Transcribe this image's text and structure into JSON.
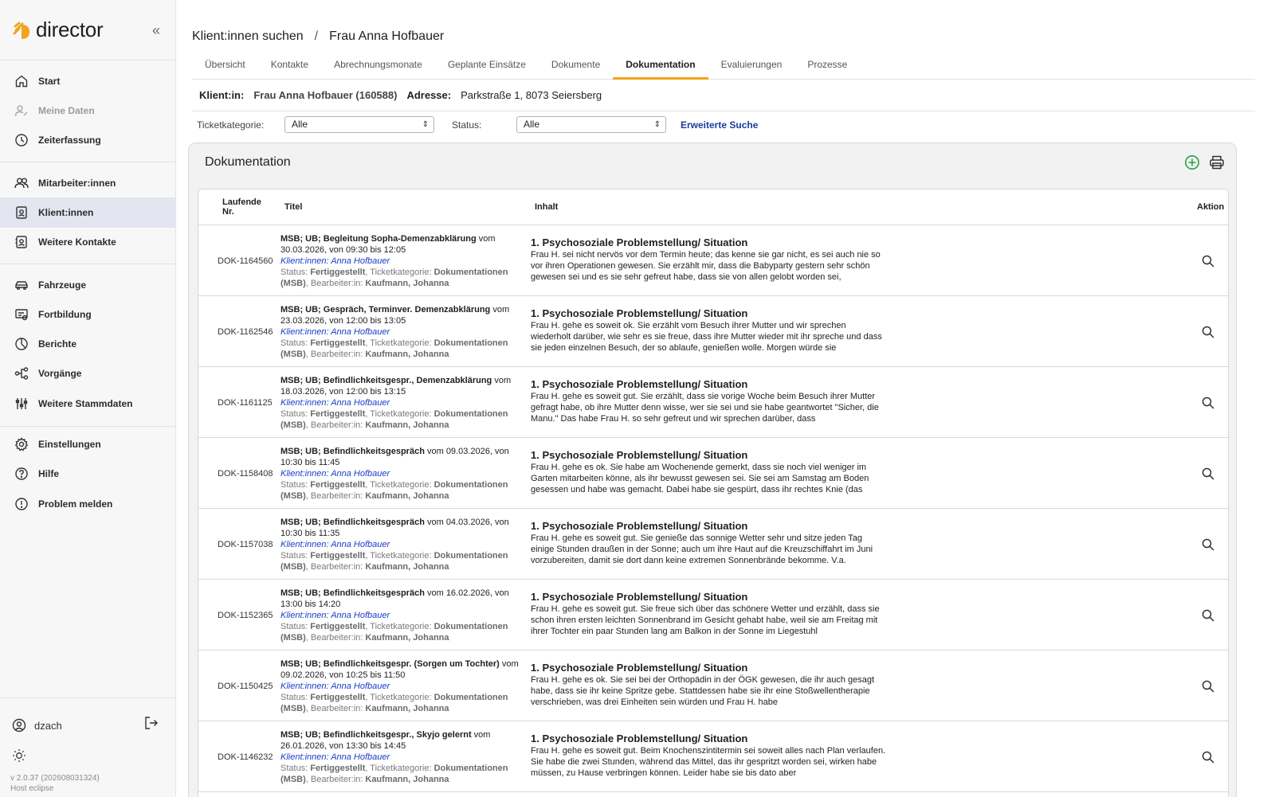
{
  "app": {
    "name": "director",
    "version": "v 2.0.37 (202608031324)",
    "host": "Host eclipse"
  },
  "sidebar": {
    "items": [
      {
        "label": "Start",
        "icon": "home-icon"
      },
      {
        "label": "Meine Daten",
        "icon": "user-edit-icon"
      },
      {
        "label": "Zeiterfassung",
        "icon": "clock-icon"
      },
      {
        "label": "Mitarbeiter:innen",
        "icon": "users-icon"
      },
      {
        "label": "Klient:innen",
        "icon": "badge-icon"
      },
      {
        "label": "Weitere Kontakte",
        "icon": "contact-icon"
      },
      {
        "label": "Fahrzeuge",
        "icon": "car-icon"
      },
      {
        "label": "Fortbildung",
        "icon": "training-icon"
      },
      {
        "label": "Berichte",
        "icon": "chart-pie-icon"
      },
      {
        "label": "Vorgänge",
        "icon": "workflow-icon"
      },
      {
        "label": "Weitere Stammdaten",
        "icon": "sliders-icon"
      },
      {
        "label": "Einstellungen",
        "icon": "gear-icon"
      },
      {
        "label": "Hilfe",
        "icon": "help-icon"
      },
      {
        "label": "Problem melden",
        "icon": "alert-icon"
      }
    ],
    "user": "dzach"
  },
  "breadcrumb": {
    "parent": "Klient:innen suchen",
    "sep": "/",
    "current": "Frau Anna Hofbauer"
  },
  "tabs": [
    "Übersicht",
    "Kontakte",
    "Abrechnungsmonate",
    "Geplante Einsätze",
    "Dokumente",
    "Dokumentation",
    "Evaluierungen",
    "Prozesse"
  ],
  "client": {
    "label": "Klient:in:",
    "name": "Frau Anna Hofbauer (160588)",
    "address_label": "Adresse:",
    "address": "Parkstraße 1, 8073 Seiersberg"
  },
  "filters": {
    "category_label": "Ticketkategorie:",
    "category_value": "Alle",
    "status_label": "Status:",
    "status_value": "Alle",
    "advanced": "Erweiterte Suche"
  },
  "panel": {
    "title": "Dokumentation"
  },
  "table": {
    "headers": {
      "nr": "Laufende",
      "nr2": "Nr.",
      "title": "Titel",
      "content": "Inhalt",
      "action": "Aktion"
    },
    "rows": [
      {
        "nr": "DOK-1164560",
        "title_bold": "MSB; UB; Begleitung Sopha-Demenzabklärung",
        "title_rest": " vom 30.03.2026, von 09:30 bis 12:05",
        "client": "Klient:innen: Anna Hofbauer",
        "status_pre": "Status: ",
        "status": "Fertiggestellt",
        "cat_pre": ", Ticketkategorie: ",
        "cat": "Dokumentationen (MSB)",
        "worker_pre": ", Bearbeiter:in: ",
        "worker": "Kaufmann, Johanna",
        "content_title": "1. Psychosoziale Problemstellung/ Situation",
        "content": "Frau H. sei nicht nervös vor dem Termin heute; das kenne sie gar nicht, es sei auch nie so vor ihren Operationen gewesen. Sie erzählt mir, dass die Babyparty gestern sehr schön gewesen sei und es sie sehr gefreut habe, dass sie von allen gelobt worden sei,"
      },
      {
        "nr": "DOK-1162546",
        "title_bold": "MSB; UB; Gespräch, Terminver. Demenzabklärung",
        "title_rest": " vom 23.03.2026, von 12:00 bis 13:05",
        "client": "Klient:innen: Anna Hofbauer",
        "status_pre": "Status: ",
        "status": "Fertiggestellt",
        "cat_pre": ", Ticketkategorie: ",
        "cat": "Dokumentationen (MSB)",
        "worker_pre": ", Bearbeiter:in: ",
        "worker": "Kaufmann, Johanna",
        "content_title": "1. Psychosoziale Problemstellung/ Situation",
        "content": "Frau H. gehe es soweit ok. Sie erzählt vom Besuch ihrer Mutter und wir sprechen wiederholt darüber, wie sehr es sie freue, dass ihre Mutter wieder mit ihr spreche und dass sie jeden einzelnen Besuch, der so ablaufe, genießen wolle. Morgen würde sie"
      },
      {
        "nr": "DOK-1161125",
        "title_bold": "MSB; UB; Befindlichkeitsgespr., Demenzabklärung",
        "title_rest": " vom 18.03.2026, von 12:00 bis 13:15",
        "client": "Klient:innen: Anna Hofbauer",
        "status_pre": "Status: ",
        "status": "Fertiggestellt",
        "cat_pre": ", Ticketkategorie: ",
        "cat": "Dokumentationen (MSB)",
        "worker_pre": ", Bearbeiter:in: ",
        "worker": "Kaufmann, Johanna",
        "content_title": "1. Psychosoziale Problemstellung/ Situation",
        "content": "Frau H. gehe es soweit gut. Sie erzählt, dass sie vorige Woche beim Besuch ihrer Mutter gefragt habe, ob ihre Mutter denn wisse, wer sie sei und sie habe geantwortet \"Sicher, die Manu.\" Das habe Frau H. so sehr gefreut und wir sprechen darüber, dass"
      },
      {
        "nr": "DOK-1158408",
        "title_bold": "MSB; UB; Befindlichkeitsgespräch",
        "title_rest": " vom 09.03.2026, von 10:30 bis 11:45",
        "client": "Klient:innen: Anna Hofbauer",
        "status_pre": "Status: ",
        "status": "Fertiggestellt",
        "cat_pre": ", Ticketkategorie: ",
        "cat": "Dokumentationen (MSB)",
        "worker_pre": ", Bearbeiter:in: ",
        "worker": "Kaufmann, Johanna",
        "content_title": "1. Psychosoziale Problemstellung/ Situation",
        "content": "Frau H. gehe es ok. Sie habe am Wochenende gemerkt, dass sie noch viel weniger im Garten mitarbeiten könne, als ihr bewusst gewesen sei. Sie sei am Samstag am Boden gesessen und habe was gemacht. Dabei habe sie gespürt, dass ihr rechtes Knie (das"
      },
      {
        "nr": "DOK-1157038",
        "title_bold": "MSB; UB; Befindlichkeitsgespräch",
        "title_rest": " vom 04.03.2026, von 10:30 bis 11:35",
        "client": "Klient:innen: Anna Hofbauer",
        "status_pre": "Status: ",
        "status": "Fertiggestellt",
        "cat_pre": ", Ticketkategorie: ",
        "cat": "Dokumentationen (MSB)",
        "worker_pre": ", Bearbeiter:in: ",
        "worker": "Kaufmann, Johanna",
        "content_title": "1. Psychosoziale Problemstellung/ Situation",
        "content": "Frau H. gehe es soweit gut. Sie genieße das sonnige Wetter sehr und sitze jeden Tag einige Stunden draußen in der Sonne; auch um ihre Haut auf die Kreuzschiffahrt im Juni vorzubereiten, damit sie dort dann keine extremen Sonnenbrände bekomme. V.a."
      },
      {
        "nr": "DOK-1152365",
        "title_bold": "MSB; UB; Befindlichkeitsgespräch",
        "title_rest": " vom 16.02.2026, von 13:00 bis 14:20",
        "client": "Klient:innen: Anna Hofbauer",
        "status_pre": "Status: ",
        "status": "Fertiggestellt",
        "cat_pre": ", Ticketkategorie: ",
        "cat": "Dokumentationen (MSB)",
        "worker_pre": ", Bearbeiter:in: ",
        "worker": "Kaufmann, Johanna",
        "content_title": "1. Psychosoziale Problemstellung/ Situation",
        "content": "Frau H. gehe es soweit gut. Sie freue sich über das schönere Wetter und erzählt, dass sie schon ihren ersten leichten Sonnenbrand im Gesicht gehabt habe, weil sie am Freitag mit ihrer Tochter ein paar Stunden lang am Balkon in der Sonne im Liegestuhl"
      },
      {
        "nr": "DOK-1150425",
        "title_bold": "MSB; UB; Befindlichkeitsgespr. (Sorgen um Tochter)",
        "title_rest": " vom 09.02.2026, von 10:25 bis 11:50",
        "client": "Klient:innen: Anna Hofbauer",
        "status_pre": "Status: ",
        "status": "Fertiggestellt",
        "cat_pre": ", Ticketkategorie: ",
        "cat": "Dokumentationen (MSB)",
        "worker_pre": ", Bearbeiter:in: ",
        "worker": "Kaufmann, Johanna",
        "content_title": "1. Psychosoziale Problemstellung/ Situation",
        "content": "Frau H. gehe es ok. Sie sei bei der Orthopädin in der ÖGK gewesen, die ihr auch gesagt habe, dass sie ihr keine Spritze gebe. Stattdessen habe sie ihr eine Stoßwellentherapie verschrieben, was drei Einheiten sein würden und Frau H. habe"
      },
      {
        "nr": "DOK-1146232",
        "title_bold": "MSB; UB; Befindlichkeitsgespr., Skyjo gelernt",
        "title_rest": " vom 26.01.2026, von 13:30 bis 14:45",
        "client": "Klient:innen: Anna Hofbauer",
        "status_pre": "Status: ",
        "status": "Fertiggestellt",
        "cat_pre": ", Ticketkategorie: ",
        "cat": "Dokumentationen (MSB)",
        "worker_pre": ", Bearbeiter:in: ",
        "worker": "Kaufmann, Johanna",
        "content_title": "1. Psychosoziale Problemstellung/ Situation",
        "content": "Frau H. gehe es soweit gut. Beim Knochenszintitermin sei soweit alles nach Plan verlaufen. Sie habe die zwei Stunden, während das Mittel, das ihr gespritzt worden sei, wirken habe müssen, zu Hause verbringen können. Leider habe sie bis dato aber"
      }
    ]
  },
  "colors": {
    "accent": "#f0a51c",
    "link": "#1a3cc8",
    "add": "#2e9e46",
    "active_nav": "#e3e6f0"
  }
}
